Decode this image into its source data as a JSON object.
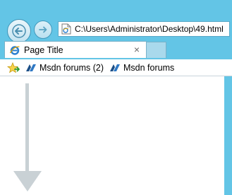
{
  "browser": {
    "address": "C:\\Users\\Administrator\\Desktop\\49.html",
    "tab": {
      "title": "Page Title",
      "close_glyph": "×"
    },
    "favorites": [
      {
        "label": "Msdn forums (2)",
        "icon": "msdn-icon"
      },
      {
        "label": "Msdn forums",
        "icon": "msdn-icon"
      }
    ]
  },
  "colors": {
    "frame": "#63c5e6",
    "arrow": "#c9d1d5"
  }
}
